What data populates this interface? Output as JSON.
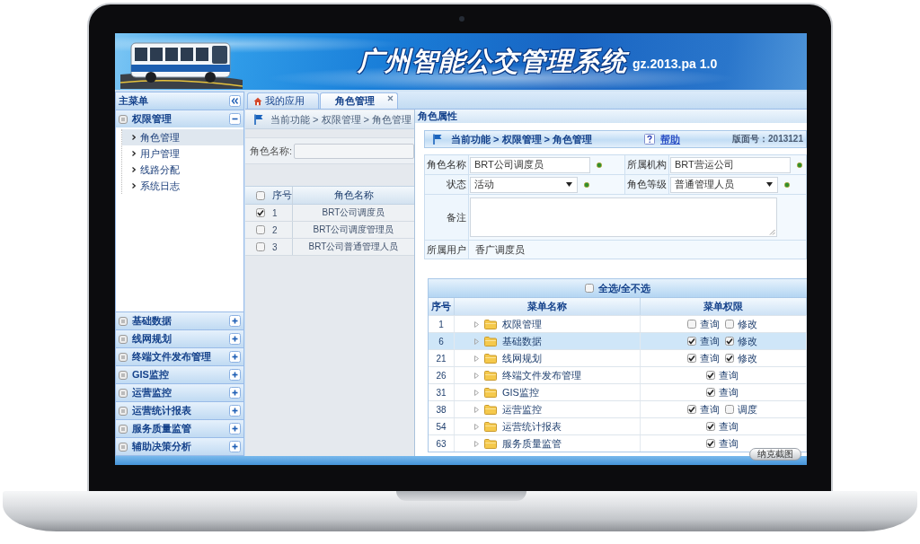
{
  "header": {
    "title": "广州智能公交管理系统",
    "version": "gz.2013.pa 1.0"
  },
  "sidebar": {
    "title": "主菜单",
    "sections": [
      {
        "label": "权限管理",
        "expanded": true,
        "items": [
          {
            "label": "角色管理",
            "selected": true
          },
          {
            "label": "用户管理",
            "selected": false
          },
          {
            "label": "线路分配",
            "selected": false
          },
          {
            "label": "系统日志",
            "selected": false
          }
        ]
      },
      {
        "label": "基础数据",
        "expanded": false
      },
      {
        "label": "线网规划",
        "expanded": false
      },
      {
        "label": "终端文件发布管理",
        "expanded": false
      },
      {
        "label": "GIS监控",
        "expanded": false
      },
      {
        "label": "运营监控",
        "expanded": false
      },
      {
        "label": "运营统计报表",
        "expanded": false
      },
      {
        "label": "服务质量监管",
        "expanded": false
      },
      {
        "label": "辅助决策分析",
        "expanded": false
      }
    ]
  },
  "tabs": [
    {
      "label": "我的应用",
      "kind": "home",
      "selected": false
    },
    {
      "label": "角色管理",
      "kind": "page",
      "selected": true
    }
  ],
  "role_list": {
    "breadcrumb": "当前功能 > 权限管理 > 角色管理",
    "search": {
      "label": "角色名称:"
    },
    "table": {
      "columns": [
        "序号",
        "角色名称"
      ],
      "all_checked": false,
      "rows": [
        {
          "no": "1",
          "name": "BRT公司调度员",
          "checked": true
        },
        {
          "no": "2",
          "name": "BRT公司调度管理员",
          "checked": false
        },
        {
          "no": "3",
          "name": "BRT公司普通管理人员",
          "checked": false
        }
      ]
    }
  },
  "role_properties": {
    "title": "角色属性",
    "breadcrumb": "当前功能 > 权限管理 > 角色管理",
    "help": "帮助",
    "version": "版面号：2013121",
    "form": {
      "rows": [
        {
          "fields": [
            {
              "label": "角色名称",
              "kind": "text",
              "value": "BRT公司调度员",
              "required": true
            },
            {
              "label": "所属机构",
              "kind": "text",
              "value": "BRT营运公司",
              "required": true
            }
          ]
        },
        {
          "fields": [
            {
              "label": "状态",
              "kind": "select",
              "value": "活动",
              "required": true
            },
            {
              "label": "角色等级",
              "kind": "select",
              "value": "普通管理人员",
              "required": true
            }
          ]
        },
        {
          "fields": [
            {
              "label": "备注",
              "kind": "textarea",
              "required": false
            }
          ]
        },
        {
          "fields": [
            {
              "label": "所属用户",
              "kind": "static",
              "value": "香广调度员",
              "required": false
            }
          ]
        }
      ]
    },
    "permissions": {
      "select_all": {
        "label": "全选/全不选",
        "checked": false
      },
      "columns": [
        "序号",
        "菜单名称",
        "菜单权限"
      ],
      "rows": [
        {
          "no": "1",
          "name": "权限管理",
          "selected": false,
          "rights": [
            {
              "label": "查询",
              "checked": false
            },
            {
              "label": "修改",
              "checked": false
            }
          ]
        },
        {
          "no": "6",
          "name": "基础数据",
          "selected": true,
          "rights": [
            {
              "label": "查询",
              "checked": true
            },
            {
              "label": "修改",
              "checked": true
            }
          ]
        },
        {
          "no": "21",
          "name": "线网规划",
          "selected": false,
          "rights": [
            {
              "label": "查询",
              "checked": true
            },
            {
              "label": "修改",
              "checked": true
            }
          ]
        },
        {
          "no": "26",
          "name": "终端文件发布管理",
          "selected": false,
          "rights": [
            {
              "label": "查询",
              "checked": true
            }
          ]
        },
        {
          "no": "31",
          "name": "GIS监控",
          "selected": false,
          "rights": [
            {
              "label": "查询",
              "checked": true
            }
          ]
        },
        {
          "no": "38",
          "name": "运营监控",
          "selected": false,
          "rights": [
            {
              "label": "查询",
              "checked": true
            },
            {
              "label": "调度",
              "checked": false
            }
          ]
        },
        {
          "no": "54",
          "name": "运营统计报表",
          "selected": false,
          "rights": [
            {
              "label": "查询",
              "checked": true
            }
          ]
        },
        {
          "no": "63",
          "name": "服务质量监管",
          "selected": false,
          "rights": [
            {
              "label": "查询",
              "checked": true
            }
          ]
        }
      ]
    }
  },
  "footer": {
    "button": "纳克截图"
  }
}
